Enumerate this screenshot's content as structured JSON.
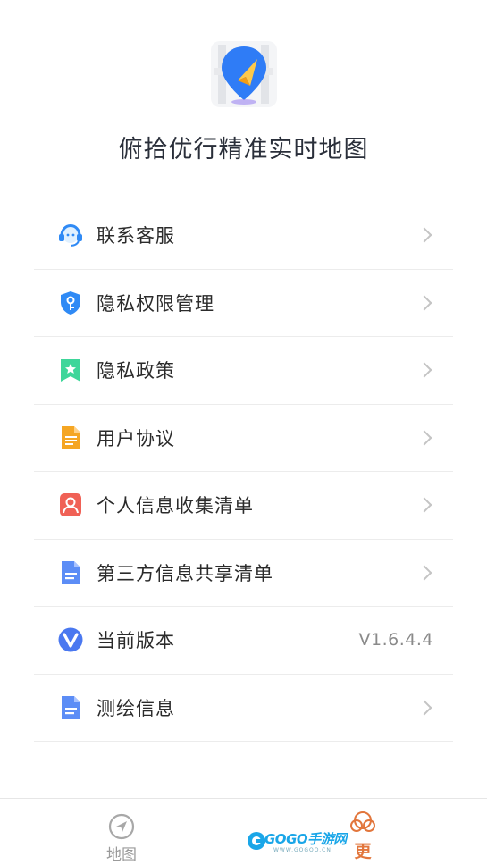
{
  "header": {
    "app_title": "俯拾优行精准实时地图"
  },
  "menu": {
    "items": [
      {
        "id": "customer-service",
        "label": "联系客服",
        "icon": "headset-icon"
      },
      {
        "id": "permissions",
        "label": "隐私权限管理",
        "icon": "shield-key-icon"
      },
      {
        "id": "privacy-policy",
        "label": "隐私政策",
        "icon": "bookmark-star-icon"
      },
      {
        "id": "user-agreement",
        "label": "用户协议",
        "icon": "document-icon"
      },
      {
        "id": "personal-info",
        "label": "个人信息收集清单",
        "icon": "person-card-icon"
      },
      {
        "id": "third-party",
        "label": "第三方信息共享清单",
        "icon": "doc-lines-icon"
      },
      {
        "id": "version",
        "label": "当前版本",
        "icon": "v-logo-icon",
        "value": "V1.6.4.4"
      },
      {
        "id": "survey-info",
        "label": "测绘信息",
        "icon": "doc-lines-icon"
      }
    ]
  },
  "tabbar": {
    "map_label": "地图"
  },
  "watermark": {
    "brand": "GOGO手游网",
    "url": "WWW.GOGOO.CN",
    "badge": "更"
  },
  "colors": {
    "accent_blue": "#2f7cf6",
    "icon_orange": "#f5a623",
    "icon_red": "#f06156",
    "icon_green": "#3ed69a",
    "text_primary": "#2b2b2b",
    "text_secondary": "#8a8a8a"
  }
}
